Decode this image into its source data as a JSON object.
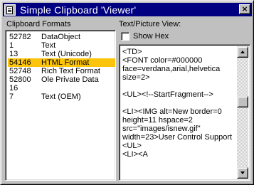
{
  "window": {
    "title": "Simple Clipboard 'Viewer'",
    "close_label": "×"
  },
  "left_panel": {
    "label": "Clipboard Formats",
    "formats": [
      {
        "id": "52782",
        "name": "DataObject"
      },
      {
        "id": "1",
        "name": "Text"
      },
      {
        "id": "13",
        "name": "Text (Unicode)"
      },
      {
        "id": "54146",
        "name": "HTML Format",
        "selected": true
      },
      {
        "id": "52748",
        "name": "Rich Text Format"
      },
      {
        "id": "52800",
        "name": "Ole Private Data"
      },
      {
        "id": "16",
        "name": ""
      },
      {
        "id": "7",
        "name": "Text (OEM)"
      }
    ]
  },
  "right_panel": {
    "label": "Text/Picture View:",
    "show_hex_label": "Show Hex",
    "show_hex_checked": false,
    "content": "<TD>\n<FONT color=#000000\nface=verdana,arial,helvetica\nsize=2>\n\n<UL><!--StartFragment-->\n\n<LI><IMG alt=New border=0\nheight=11 hspace=2\nsrc=\"images/isnew.gif\"\nwidth=23>User Control Support\n<UL>\n<LI><A"
  },
  "colors": {
    "titlebar": "#000080",
    "selection": "#fcc40a",
    "face": "#c0c0c0"
  }
}
